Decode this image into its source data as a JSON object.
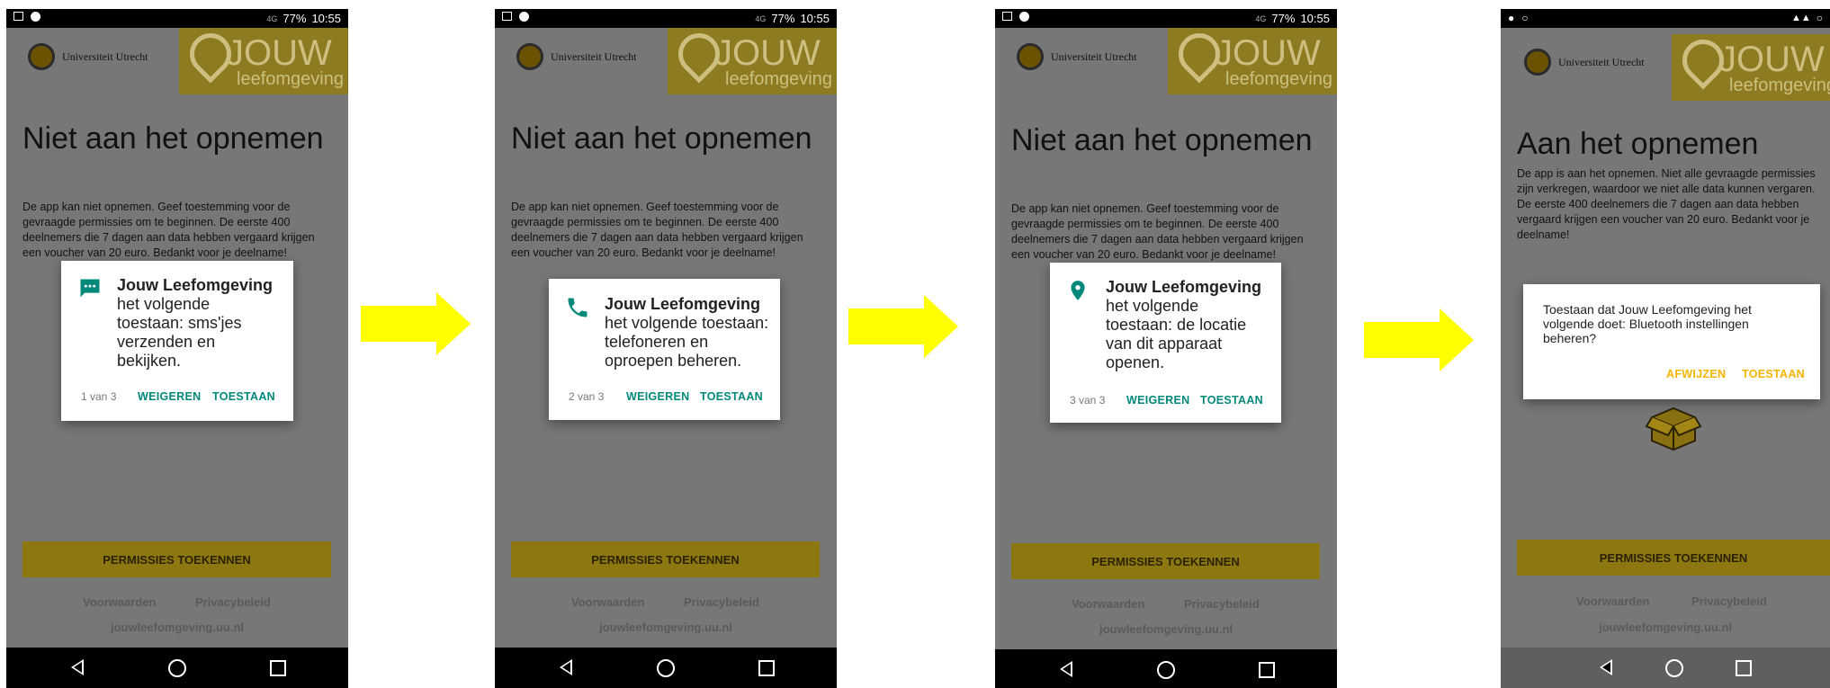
{
  "status": {
    "battery": "77%",
    "time": "10:55",
    "network": "4G"
  },
  "brand": {
    "university": "Universiteit Utrecht",
    "logo_line1": "JOUW",
    "logo_line2": "leefomgeving"
  },
  "page": {
    "title_not_recording": "Niet aan het opnemen",
    "text_not_recording": "De app kan niet opnemen. Geef toestemming voor de gevraagde permissies om te beginnen. De eerste 400 deelnemers die 7 dagen aan data hebben vergaard krijgen een voucher van 20 euro. Bedankt voor je deelname!",
    "title_recording": "Aan het opnemen",
    "text_recording": "De app is aan het opnemen. Niet alle gevraagde permissies zijn verkregen, waardoor we niet alle data kunnen vergaren. De eerste 400 deelnemers die 7 dagen aan data hebben vergaard krijgen een voucher van 20 euro. Bedankt voor je deelname!",
    "grant_button": "PERMISSIES TOEKENNEN",
    "link_terms": "Voorwaarden",
    "link_privacy": "Privacybeleid",
    "site": "jouwleefomgeving.uu.nl"
  },
  "dialogs": [
    {
      "app": "Jouw Leefomgeving",
      "text": "het volgende toestaan: sms'jes verzenden en bekijken.",
      "counter": "1 van 3",
      "deny": "WEIGEREN",
      "allow": "TOESTAAN",
      "icon": "message-icon"
    },
    {
      "app": "Jouw Leefomgeving",
      "text": "het volgende toestaan: telefoneren en oproepen beheren.",
      "counter": "2 van 3",
      "deny": "WEIGEREN",
      "allow": "TOESTAAN",
      "icon": "phone-icon"
    },
    {
      "app": "Jouw Leefomgeving",
      "text": "het volgende toestaan: de locatie van dit apparaat openen.",
      "counter": "3 van 3",
      "deny": "WEIGEREN",
      "allow": "TOESTAAN",
      "icon": "location-pin-icon"
    },
    {
      "text": "Toestaan dat Jouw Leefomgeving het volgende doet: Bluetooth instellingen beheren?",
      "deny": "AFWIJZEN",
      "allow": "TOESTAAN"
    }
  ],
  "colors": {
    "arrow": "#ffff00",
    "teal": "#00897b",
    "amber": "#f5b400",
    "gold": "#8c7710"
  }
}
